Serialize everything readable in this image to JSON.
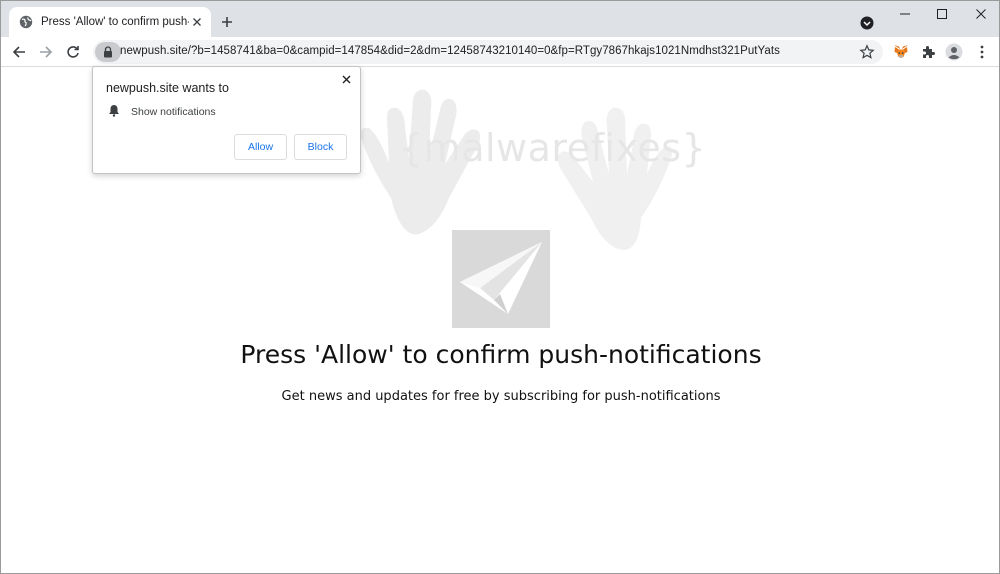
{
  "browser": {
    "tab": {
      "title": "Press 'Allow' to confirm push-notifications"
    },
    "omnibox": {
      "url": "newpush.site/?b=1458741&ba=0&campid=147854&did=2&dm=12458743210140=0&fp=RTgy7867hkajs1021Nmdhst321PutYats"
    },
    "icons": [
      "globe-icon",
      "close-icon",
      "plus-icon",
      "tab-search-icon",
      "minimize-icon",
      "maximize-icon",
      "close-window-icon",
      "back-icon",
      "forward-icon",
      "reload-icon",
      "lock-icon",
      "star-icon",
      "metamask-icon",
      "puzzle-icon",
      "profile-icon",
      "menu-icon"
    ]
  },
  "popup": {
    "title": "newpush.site wants to",
    "permission": "Show notifications",
    "allow_label": "Allow",
    "block_label": "Block"
  },
  "page": {
    "watermark": "{malwarefixes}",
    "headline": "Press 'Allow' to confirm push-notifications",
    "subline": "Get news and updates for free by subscribing for push-notifications"
  }
}
